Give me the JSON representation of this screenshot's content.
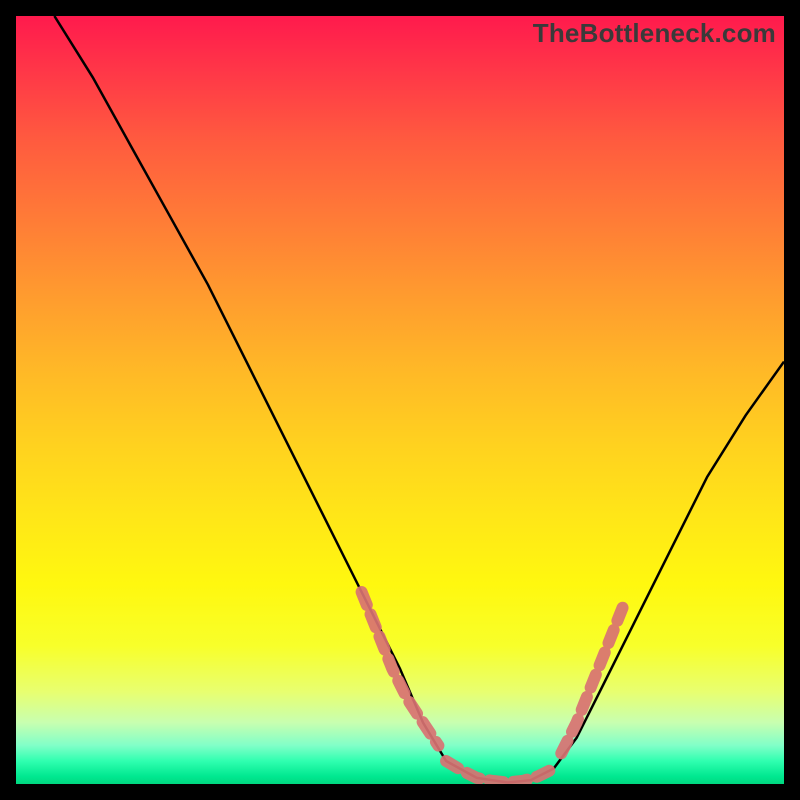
{
  "watermark": "TheBottleneck.com",
  "chart_data": {
    "type": "line",
    "title": "",
    "xlabel": "",
    "ylabel": "",
    "xlim": [
      0,
      100
    ],
    "ylim": [
      0,
      100
    ],
    "grid": false,
    "legend": false,
    "series": [
      {
        "name": "curve",
        "color": "#000000",
        "x": [
          5,
          10,
          15,
          20,
          25,
          30,
          35,
          40,
          45,
          50,
          53,
          56,
          60,
          64,
          67,
          70,
          73,
          76,
          80,
          85,
          90,
          95,
          100
        ],
        "y": [
          100,
          92,
          83,
          74,
          65,
          55,
          45,
          35,
          25,
          15,
          8,
          3,
          0.8,
          0.2,
          0.5,
          2,
          6,
          12,
          20,
          30,
          40,
          48,
          55
        ]
      }
    ],
    "highlight_segments": [
      {
        "x": [
          45,
          47,
          49,
          51,
          53,
          55
        ],
        "y": [
          25,
          20,
          15,
          11,
          8,
          5
        ]
      },
      {
        "x": [
          56,
          58,
          60,
          62,
          64,
          66,
          68,
          70
        ],
        "y": [
          3,
          1.8,
          0.8,
          0.4,
          0.2,
          0.4,
          1.0,
          2.0
        ]
      },
      {
        "x": [
          71,
          73,
          75,
          77,
          79
        ],
        "y": [
          4,
          8,
          13,
          18,
          23
        ]
      }
    ],
    "highlight_style": {
      "color": "#d87272",
      "dash": [
        14,
        10
      ],
      "width": 12,
      "linecap": "round"
    },
    "gradient_stops": [
      {
        "pos": 0,
        "color": "#ff1a4d"
      },
      {
        "pos": 50,
        "color": "#ffd21f"
      },
      {
        "pos": 85,
        "color": "#f8ff2a"
      },
      {
        "pos": 100,
        "color": "#00d880"
      }
    ]
  }
}
